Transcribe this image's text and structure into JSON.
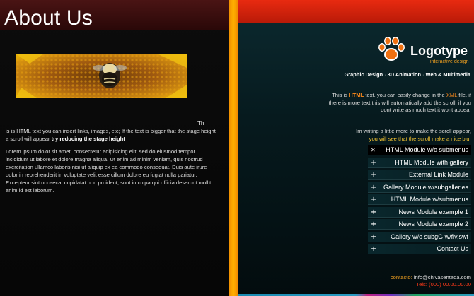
{
  "left": {
    "title": "About Us",
    "th_fragment": "Th",
    "para1_text": "is is HTML text you can insert links, images, etc; If the text is bigger that the stage height a scroll will appear ",
    "para1_bold": "try reducing the stage height",
    "para2": "Lorem ipsum dolor sit amet, consectetur adipisicing elit, sed do eiusmod tempor incididunt ut labore et dolore magna aliqua. Ut enim ad minim veniam, quis nostrud exercitation ullamco laboris nisi ut aliquip ex ea commodo consequat. Duis aute irure dolor in reprehenderit in voluptate velit esse cillum dolore eu fugiat nulla pariatur. Excepteur sint occaecat cupidatat non proident, sunt in culpa qui officia deserunt mollit anim id est laborum."
  },
  "close_icon": "close-icon",
  "logo": {
    "icon": "paw-icon",
    "name": "Logotype",
    "tagline": "interactive design"
  },
  "services": [
    "Graphic Design",
    "3D Animation",
    "Web & Multimedia"
  ],
  "intro": {
    "p1_a": "This is ",
    "p1_hl": "HTML",
    "p1_b": " text, you can easily change in the ",
    "p1_hl2": "XML",
    "p1_c": " file, if there is more text this will automatically add the scroll. if you dont write as much text it wont appear",
    "p2_a": "Im writing a little more to make the scroll appear,",
    "p2_b": "you will see that the scroll make a nice blur"
  },
  "menu": [
    {
      "label": "HTML Module w/o submenus",
      "icon": "close-icon",
      "active": true
    },
    {
      "label": "HTML Module with gallery",
      "icon": "plus-icon",
      "active": false
    },
    {
      "label": "External Link Module",
      "icon": "plus-icon",
      "active": false
    },
    {
      "label": "Gallery Module w/subgalleries",
      "icon": "plus-icon",
      "active": false
    },
    {
      "label": "HTML Module w/submenus",
      "icon": "plus-icon",
      "active": false
    },
    {
      "label": "News Module example 1",
      "icon": "plus-icon",
      "active": false
    },
    {
      "label": "News Module example 2",
      "icon": "plus-icon",
      "active": false
    },
    {
      "label": "Gallery w/o subgG w/flv,swf",
      "icon": "plus-icon",
      "active": false
    },
    {
      "label": "Contact Us",
      "icon": "plus-icon",
      "active": false
    }
  ],
  "contact": {
    "label": "contacto:",
    "email": "info@chivasentada.com",
    "tel_label": "Tels:",
    "tel": "(000) 00.00.00.00"
  },
  "colors": {
    "accent_orange": "#f29000",
    "header_red": "#e82a10",
    "highlight": "#ff8a1a"
  }
}
